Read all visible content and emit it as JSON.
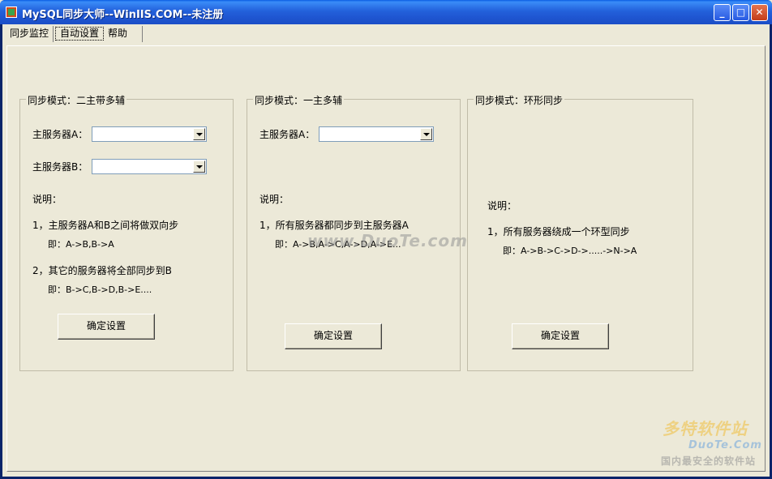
{
  "window": {
    "title": "MySQL同步大师--WinIIS.COM--未注册",
    "controls": {
      "minimize": "_",
      "maximize": "□",
      "close": "✕"
    }
  },
  "tabs": [
    {
      "label": "同步监控",
      "active": false
    },
    {
      "label": "自动设置",
      "active": true
    },
    {
      "label": "帮助",
      "active": false
    }
  ],
  "groups": {
    "dual_master": {
      "title": "同步模式：二主带多辅",
      "server_a_label": "主服务器A：",
      "server_a_value": "",
      "server_b_label": "主服务器B：",
      "server_b_value": "",
      "desc_title": "说明：",
      "line1": "1，主服务器A和B之间将做双向步",
      "line1_sub": "即：A->B,B->A",
      "line2": "2，其它的服务器将全部同步到B",
      "line2_sub": "即：B->C,B->D,B->E....",
      "confirm_label": "确定设置"
    },
    "single_master": {
      "title": "同步模式：一主多辅",
      "server_a_label": "主服务器A：",
      "server_a_value": "",
      "desc_title": "说明：",
      "line1": "1，所有服务器都同步到主服务器A",
      "line1_sub": "即：A->B,A->C,A->D,A->E...",
      "confirm_label": "确定设置"
    },
    "ring": {
      "title": "同步模式：环形同步",
      "desc_title": "说明：",
      "line1": "1，所有服务器绕成一个环型同步",
      "line1_sub": "即：A->B->C->D->.....->N->A",
      "confirm_label": "确定设置"
    }
  },
  "watermarks": {
    "center": "www.DuoTe.com",
    "corner_brand": "多特软件站",
    "corner_url": "DuoTe.Com",
    "corner_slogan": "国内最安全的软件站"
  }
}
